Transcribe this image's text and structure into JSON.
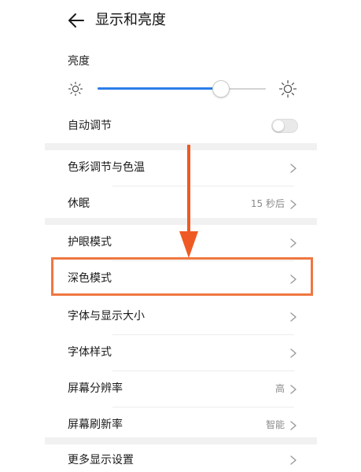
{
  "header": {
    "title": "显示和亮度",
    "back_icon": "arrow-left-icon"
  },
  "brightness": {
    "label": "亮度",
    "level_fraction": 0.75,
    "auto_label": "自动调节",
    "auto_enabled": false
  },
  "groups": [
    {
      "items": [
        {
          "label": "色彩调节与色温",
          "value": ""
        },
        {
          "label": "休眠",
          "value": "15 秒后"
        }
      ]
    },
    {
      "items": [
        {
          "label": "护眼模式",
          "value": ""
        },
        {
          "label": "深色模式",
          "value": ""
        },
        {
          "label": "字体与显示大小",
          "value": ""
        },
        {
          "label": "字体样式",
          "value": ""
        },
        {
          "label": "屏幕分辨率",
          "value": "高"
        },
        {
          "label": "屏幕刷新率",
          "value": "智能"
        }
      ]
    },
    {
      "items": [
        {
          "label": "更多显示设置",
          "value": ""
        }
      ]
    }
  ],
  "annotation": {
    "highlighted_item": "深色模式",
    "color": "#ef7741"
  },
  "colors": {
    "accent": "#2b7de9",
    "annotation": "#ef7741",
    "secondary_text": "#8a8a8a"
  }
}
